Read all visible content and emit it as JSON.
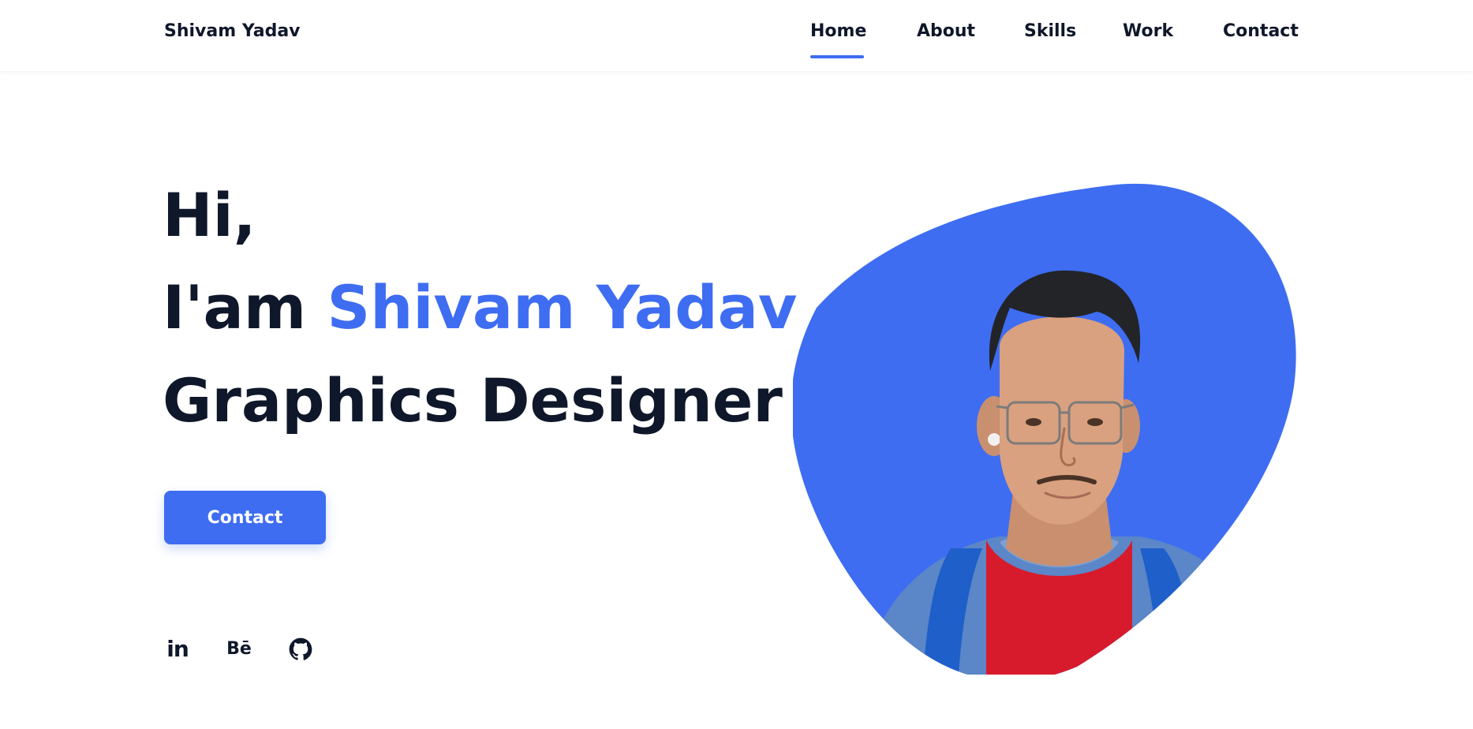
{
  "header": {
    "logo": "Shivam Yadav",
    "nav": [
      {
        "label": "Home",
        "active": true
      },
      {
        "label": "About",
        "active": false
      },
      {
        "label": "Skills",
        "active": false
      },
      {
        "label": "Work",
        "active": false
      },
      {
        "label": "Contact",
        "active": false
      }
    ]
  },
  "hero": {
    "greeting": "Hi,",
    "intro_prefix": "I'am ",
    "name": "Shivam Yadav",
    "title": "Graphics Designer",
    "contact_button": "Contact"
  },
  "social": [
    {
      "icon": "linkedin-icon",
      "text": "in"
    },
    {
      "icon": "behance-icon",
      "text": "Bē"
    },
    {
      "icon": "github-icon"
    }
  ],
  "colors": {
    "accent": "#3e6df2",
    "text_dark": "#0f172a",
    "background": "#ffffff"
  }
}
